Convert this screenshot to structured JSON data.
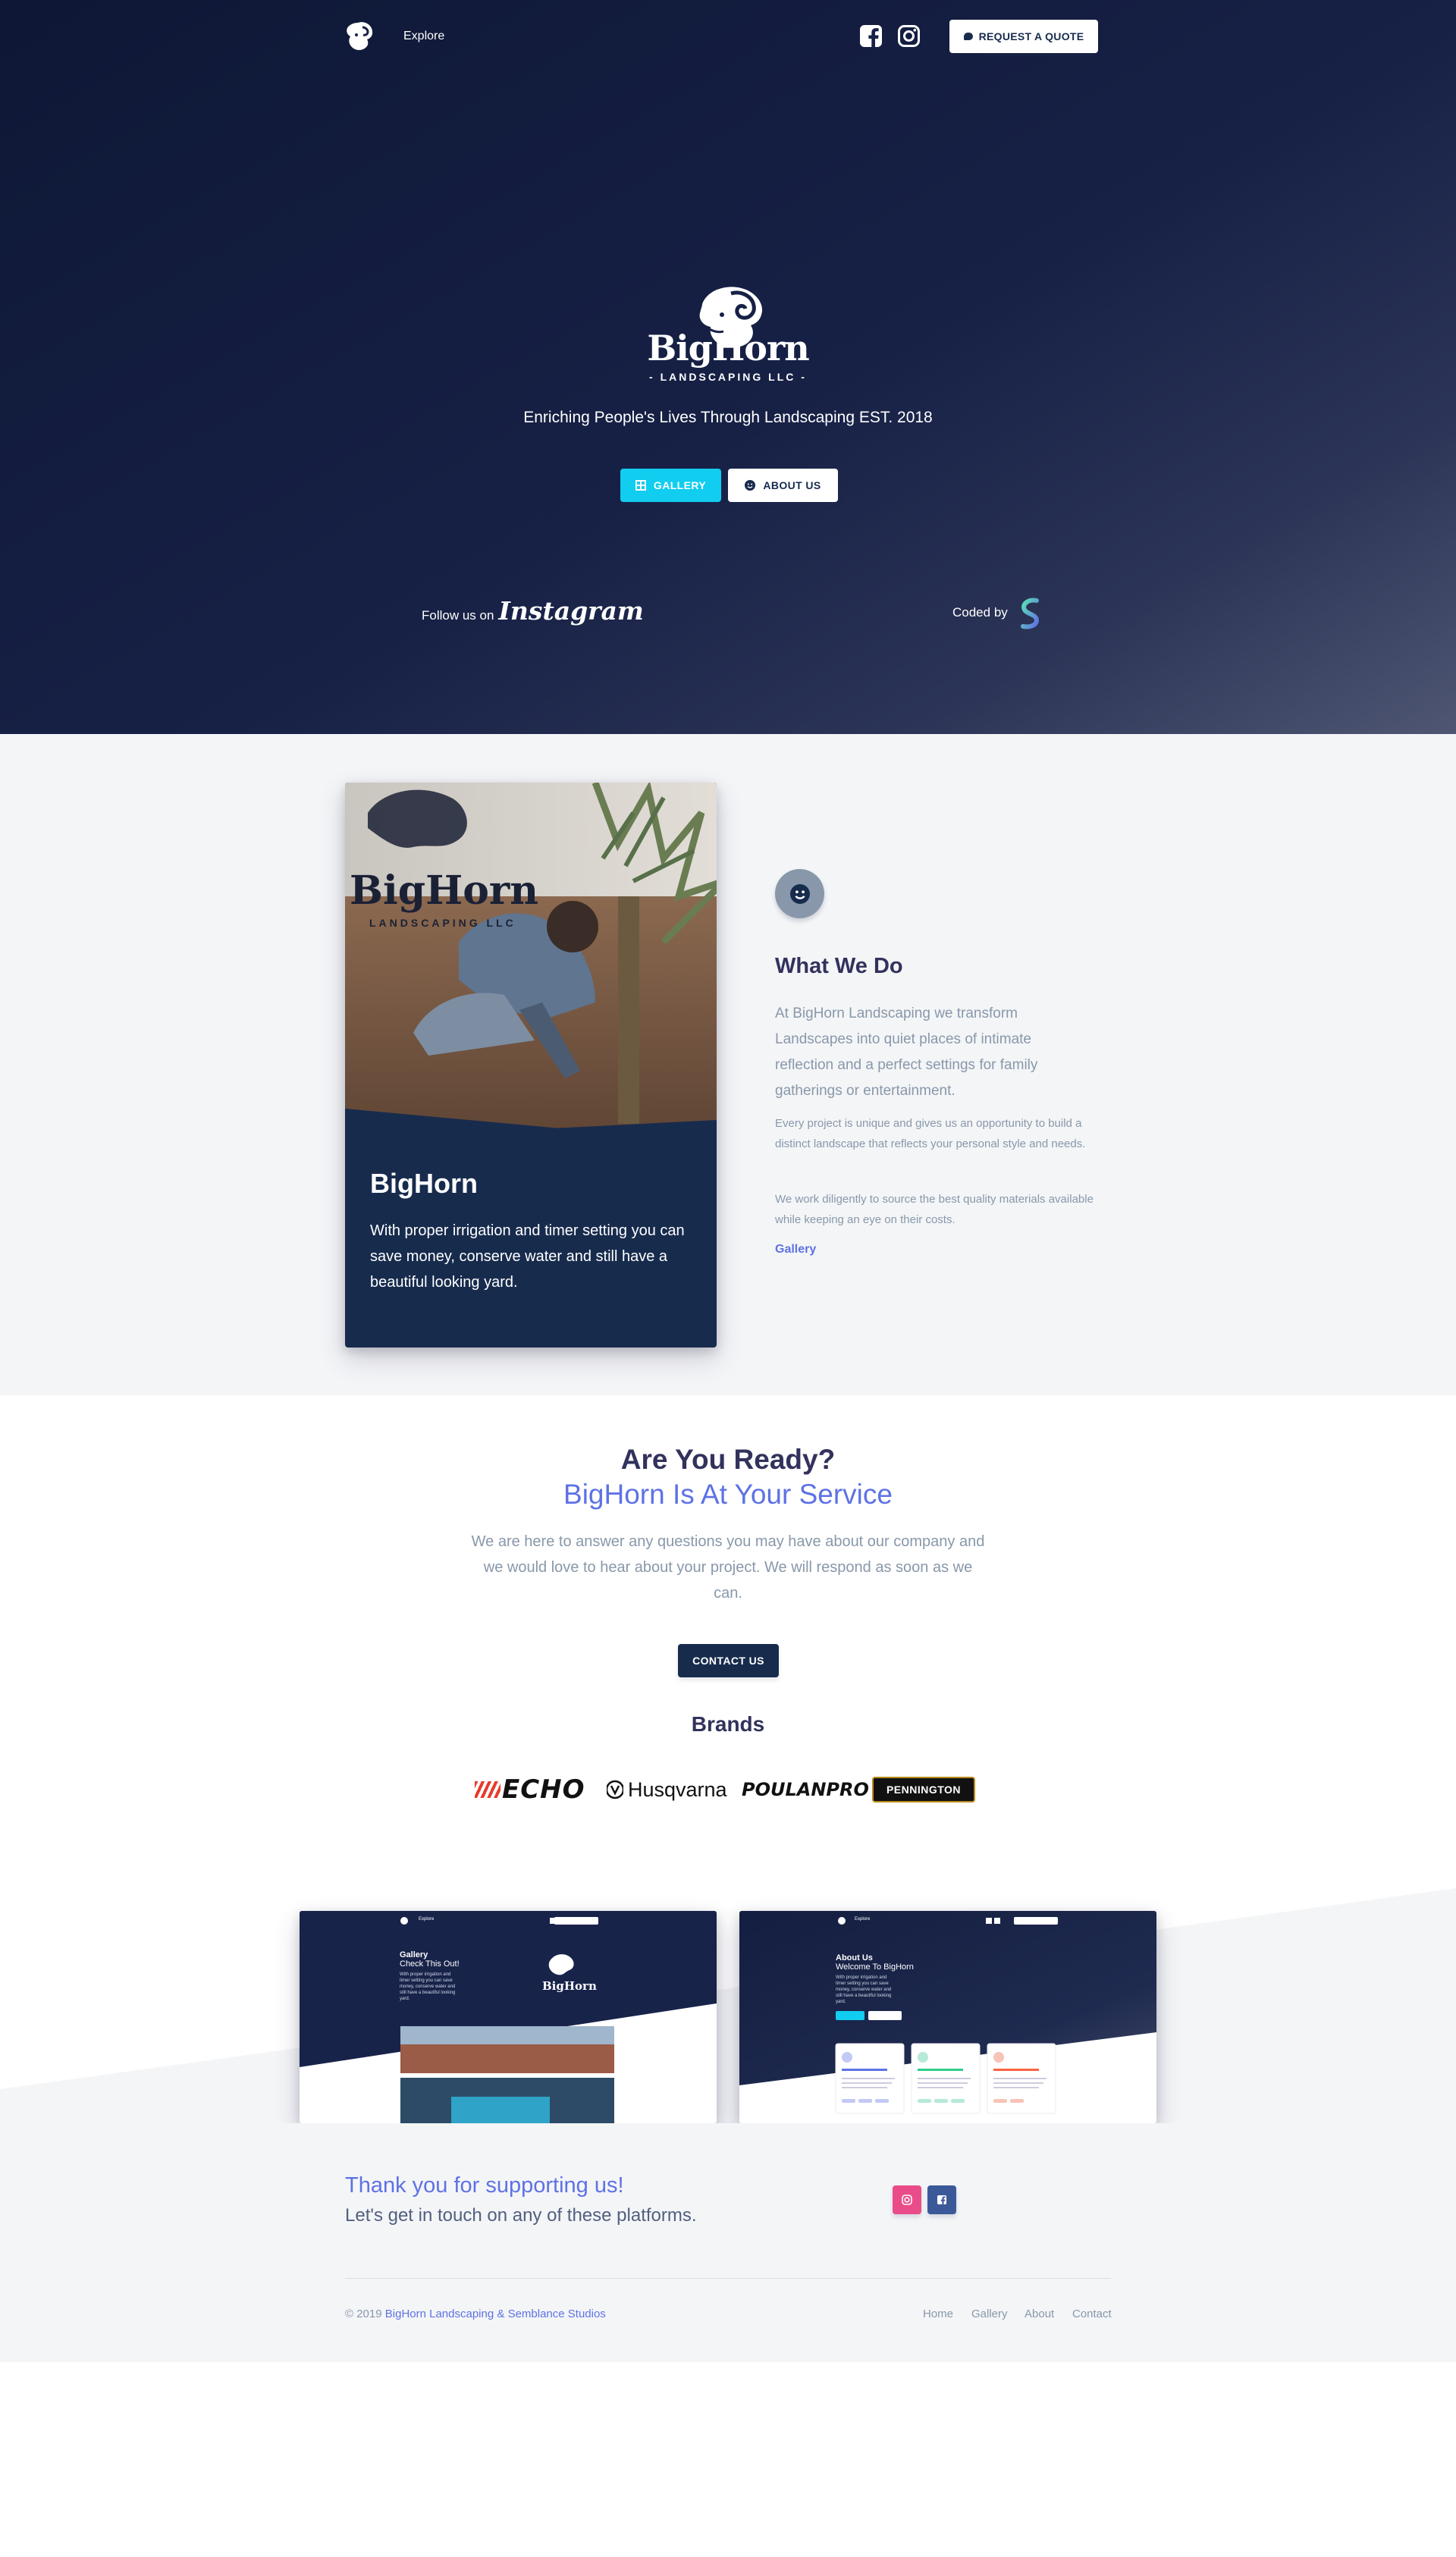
{
  "nav": {
    "explore": "Explore",
    "quote_label": "REQUEST A QUOTE"
  },
  "hero": {
    "brand_name": "BigHorn",
    "brand_sub": "- LANDSCAPING LLC -",
    "tagline": "Enriching People's Lives Through Landscaping EST. 2018",
    "gallery_label": "GALLERY",
    "about_label": "ABOUT US",
    "follow_prefix": "Follow us on",
    "follow_brand": "Instagram",
    "coded_by": "Coded by"
  },
  "card": {
    "photo_brand": "BigHorn",
    "photo_sub": "LANDSCAPING LLC",
    "title": "BigHorn",
    "text": "With proper irrigation and timer setting you can save money, conserve water and still have a beautiful looking yard."
  },
  "what": {
    "title": "What We Do",
    "lead": "At BigHorn Landscaping we transform Landscapes into quiet places of intimate reflection and a perfect settings for family gatherings or entertainment.",
    "p1": "Every project is unique and gives us an opportunity to build a distinct landscape that reflects your personal style and needs.",
    "p2": "We work diligently to source the best quality materials available while keeping an eye on their costs.",
    "link": "Gallery"
  },
  "ready": {
    "title": "Are You Ready?",
    "subtitle": "BigHorn Is At Your Service",
    "text": "We are here to answer any questions you may have about our company and we would love to hear about your project. We will respond as soon as we can.",
    "contact_label": "CONTACT US",
    "brands_title": "Brands",
    "brands": [
      "ECHO",
      "Husqvarna",
      "POULANPRO",
      "PENNINGTON"
    ]
  },
  "showcase": {
    "left": {
      "title": "Gallery",
      "subtitle": "Check This Out!",
      "nav_explore": "Explore",
      "brand": "BigHorn"
    },
    "right": {
      "title": "About Us",
      "subtitle": "Welcome To BigHorn",
      "nav_explore": "Explore"
    }
  },
  "footer": {
    "thanks": "Thank you for supporting us!",
    "touch": "Let's get in touch on any of these platforms.",
    "copy_prefix": "© 2019",
    "copy_link1": "BigHorn Landscaping",
    "copy_amp": "&",
    "copy_link2": "Semblance Studios",
    "links": [
      "Home",
      "Gallery",
      "About",
      "Contact"
    ]
  },
  "colors": {
    "hero_dark": "#0e1735",
    "primary": "#5e72e4",
    "info": "#11cdef",
    "default": "#172b4d",
    "muted": "#8898aa",
    "secondary_bg": "#f4f5f7",
    "instagram": "#ea4c89",
    "facebook": "#3b5999"
  },
  "icons": {
    "nav_logo": "bighorn-ram-icon",
    "facebook": "facebook-icon",
    "instagram": "instagram-icon",
    "quote": "chat-bubble-icon",
    "gallery": "grid-icon",
    "about": "smile-icon",
    "coded_logo": "semblance-s-icon"
  }
}
